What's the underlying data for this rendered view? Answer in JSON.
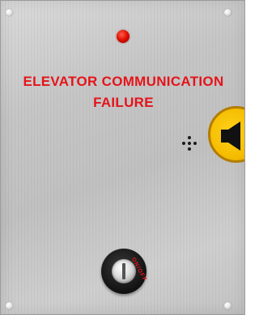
{
  "panel": {
    "heading_line_1": "ELEVATOR COMMUNICATION",
    "heading_line_2": "FAILURE",
    "key_switch_label": "ON/OFF",
    "indicator_light_color": "#e00d00",
    "text_color": "#e4141a",
    "speaker_button_color": "#f4bc00",
    "icons": {
      "speaker_button": "speaker-icon",
      "microphone": "microphone-grille-icon",
      "key_switch": "key-cylinder-icon"
    }
  }
}
